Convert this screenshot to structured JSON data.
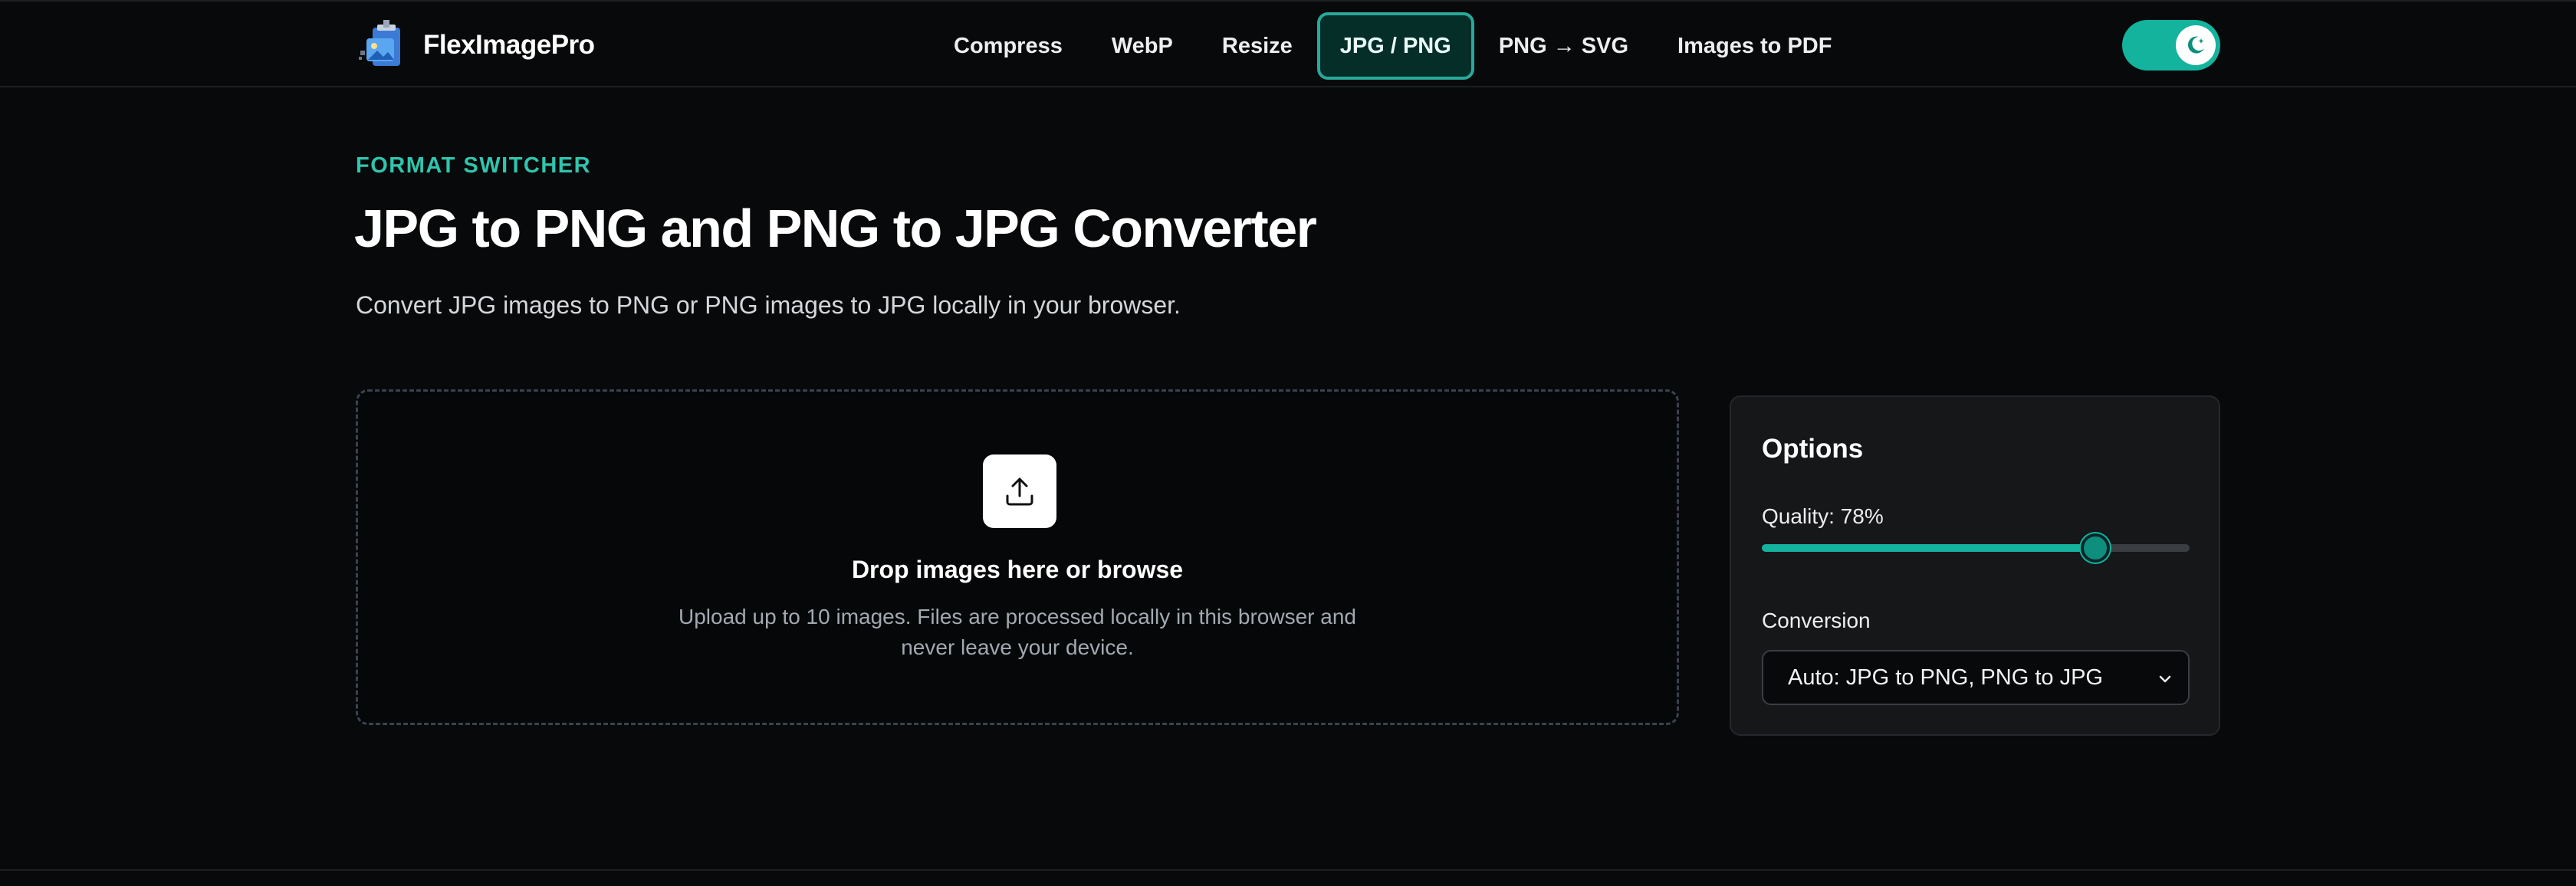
{
  "brand": {
    "name": "FlexImagePro",
    "logo_icon": "image-compress-logo-icon"
  },
  "nav": {
    "items": [
      {
        "label": "Compress",
        "active": false
      },
      {
        "label": "WebP",
        "active": false
      },
      {
        "label": "Resize",
        "active": false
      },
      {
        "label": "JPG / PNG",
        "active": true
      },
      {
        "label": "PNG → SVG",
        "active": false
      },
      {
        "label": "Images to PDF",
        "active": false
      }
    ]
  },
  "theme_toggle": {
    "icon": "moon-icon",
    "state": "dark"
  },
  "hero": {
    "eyebrow": "FORMAT SWITCHER",
    "title": "JPG to PNG and PNG to JPG Converter",
    "subtitle": "Convert JPG images to PNG or PNG images to JPG locally in your browser."
  },
  "dropzone": {
    "icon": "upload-icon",
    "title": "Drop images here or browse",
    "description": "Upload up to 10 images. Files are processed locally in this browser and never leave your device."
  },
  "options": {
    "title": "Options",
    "quality_label": "Quality: 78%",
    "quality_value": 78,
    "conversion_label": "Conversion",
    "conversion_selected": "Auto: JPG to PNG, PNG to JPG"
  },
  "colors": {
    "accent": "#13b39d",
    "eyebrow": "#2fc5ae",
    "background": "#08090a",
    "panel": "#151719"
  }
}
